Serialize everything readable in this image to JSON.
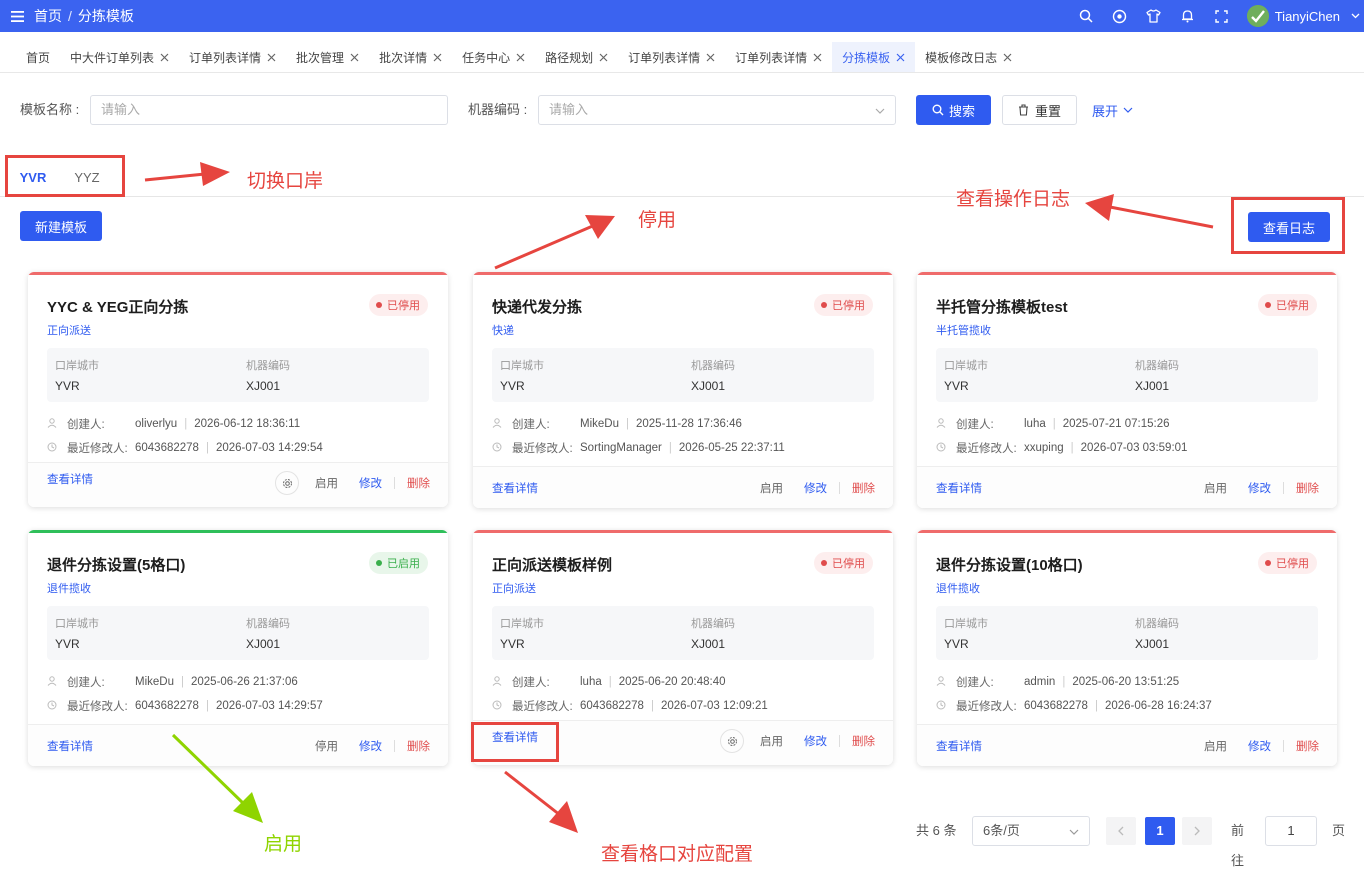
{
  "header": {
    "breadcrumb_home": "首页",
    "breadcrumb_sep": "/",
    "breadcrumb_current": "分拣模板",
    "username": "TianyiChen",
    "accent": "#3b63f0"
  },
  "tabs": [
    {
      "label": "首页",
      "closable": false
    },
    {
      "label": "中大件订单列表",
      "closable": true
    },
    {
      "label": "订单列表详情",
      "closable": true
    },
    {
      "label": "批次管理",
      "closable": true
    },
    {
      "label": "批次详情",
      "closable": true
    },
    {
      "label": "任务中心",
      "closable": true
    },
    {
      "label": "路径规划",
      "closable": true
    },
    {
      "label": "订单列表详情",
      "closable": true
    },
    {
      "label": "订单列表详情",
      "closable": true
    },
    {
      "label": "分拣模板",
      "closable": true,
      "active": true
    },
    {
      "label": "模板修改日志",
      "closable": true
    }
  ],
  "search": {
    "template_name_label": "模板名称 :",
    "template_name_placeholder": "请输入",
    "machine_code_label": "机器编码 :",
    "machine_code_placeholder": "请输入",
    "search_button": "搜索",
    "reset_button": "重置",
    "expand_link": "展开"
  },
  "ports": {
    "items": [
      "YVR",
      "YYZ"
    ],
    "active": "YVR"
  },
  "actions": {
    "new_template": "新建模板",
    "view_log": "查看日志"
  },
  "annotations": {
    "switch_port": "切换口岸",
    "disable": "停用",
    "view_log": "查看操作日志",
    "enable": "启用",
    "view_grid": "查看格口对应配置"
  },
  "labels": {
    "port_city": "口岸城市",
    "machine_code": "机器编码",
    "creator": "创建人:",
    "modifier": "最近修改人:",
    "detail": "查看详情",
    "enable": "启用",
    "disable": "停用",
    "edit": "修改",
    "delete": "删除"
  },
  "cards": [
    {
      "title": "YYC & YEG正向分拣",
      "type": "正向派送",
      "status": "已停用",
      "enabled": false,
      "port_city": "YVR",
      "machine_code": "XJ001",
      "creator": "oliverlyu",
      "created_at": "2026-06-12 18:36:11",
      "modifier": "6043682278",
      "modified_at": "2026-07-03 14:29:54",
      "action": "启用",
      "gear": true
    },
    {
      "title": "快递代发分拣",
      "type": "快递",
      "status": "已停用",
      "enabled": false,
      "port_city": "YVR",
      "machine_code": "XJ001",
      "creator": "MikeDu",
      "created_at": "2025-11-28 17:36:46",
      "modifier": "SortingManager",
      "modified_at": "2026-05-25 22:37:11",
      "action": "启用",
      "gear": false
    },
    {
      "title": "半托管分拣模板test",
      "type": "半托管揽收",
      "status": "已停用",
      "enabled": false,
      "port_city": "YVR",
      "machine_code": "XJ001",
      "creator": "luha",
      "created_at": "2025-07-21 07:15:26",
      "modifier": "xxuping",
      "modified_at": "2026-07-03 03:59:01",
      "action": "启用",
      "gear": false
    },
    {
      "title": "退件分拣设置(5格口)",
      "type": "退件揽收",
      "status": "已启用",
      "enabled": true,
      "port_city": "YVR",
      "machine_code": "XJ001",
      "creator": "MikeDu",
      "created_at": "2025-06-26 21:37:06",
      "modifier": "6043682278",
      "modified_at": "2026-07-03 14:29:57",
      "action": "停用",
      "gear": false
    },
    {
      "title": "正向派送模板样例",
      "type": "正向派送",
      "status": "已停用",
      "enabled": false,
      "port_city": "YVR",
      "machine_code": "XJ001",
      "creator": "luha",
      "created_at": "2025-06-20 20:48:40",
      "modifier": "6043682278",
      "modified_at": "2026-07-03 12:09:21",
      "action": "启用",
      "gear": true
    },
    {
      "title": "退件分拣设置(10格口)",
      "type": "退件揽收",
      "status": "已停用",
      "enabled": false,
      "port_city": "YVR",
      "machine_code": "XJ001",
      "creator": "admin",
      "created_at": "2025-06-20 13:51:25",
      "modifier": "6043682278",
      "modified_at": "2026-06-28 16:24:37",
      "action": "启用",
      "gear": false
    }
  ],
  "pagination": {
    "total": "共 6 条",
    "page_size": "6条/页",
    "current_page": "1",
    "goto_label": "前往",
    "goto_value": "1",
    "page_suffix": "页"
  }
}
